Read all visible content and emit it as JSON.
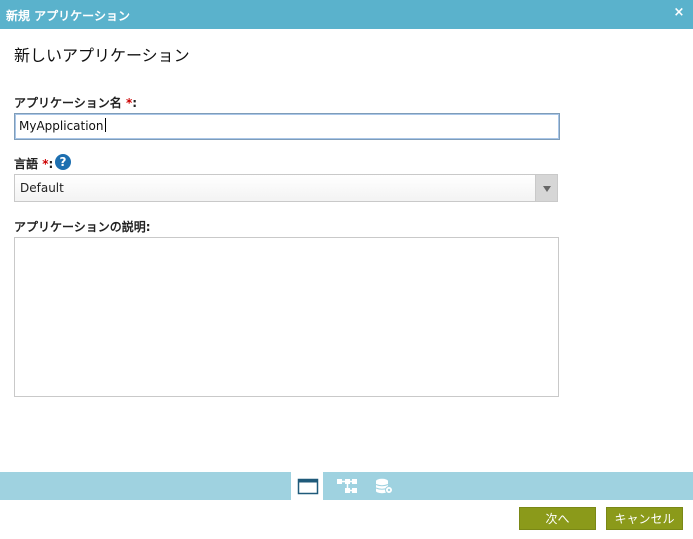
{
  "window": {
    "title": "新規 アプリケーション",
    "close_symbol": "×"
  },
  "page": {
    "heading": "新しいアプリケーション"
  },
  "form": {
    "app_name": {
      "label": "アプリケーション名",
      "required_mark": "*",
      "colon": ":",
      "value": "MyApplication"
    },
    "language": {
      "label": "言語",
      "required_mark": "*",
      "colon": ":",
      "help_symbol": "?",
      "selected": "Default"
    },
    "description": {
      "label": "アプリケーションの説明:",
      "value": ""
    }
  },
  "tabs": [
    {
      "icon": "window-icon",
      "active": true
    },
    {
      "icon": "workflow-icon",
      "active": false
    },
    {
      "icon": "database-icon",
      "active": false
    }
  ],
  "buttons": {
    "next": "次へ",
    "cancel": "キャンセル"
  },
  "colors": {
    "titlebar": "#5ab2cc",
    "tabbar": "#9fd2e0",
    "button": "#8b9a1a",
    "required": "#cc0000",
    "help": "#1d6fb0"
  }
}
